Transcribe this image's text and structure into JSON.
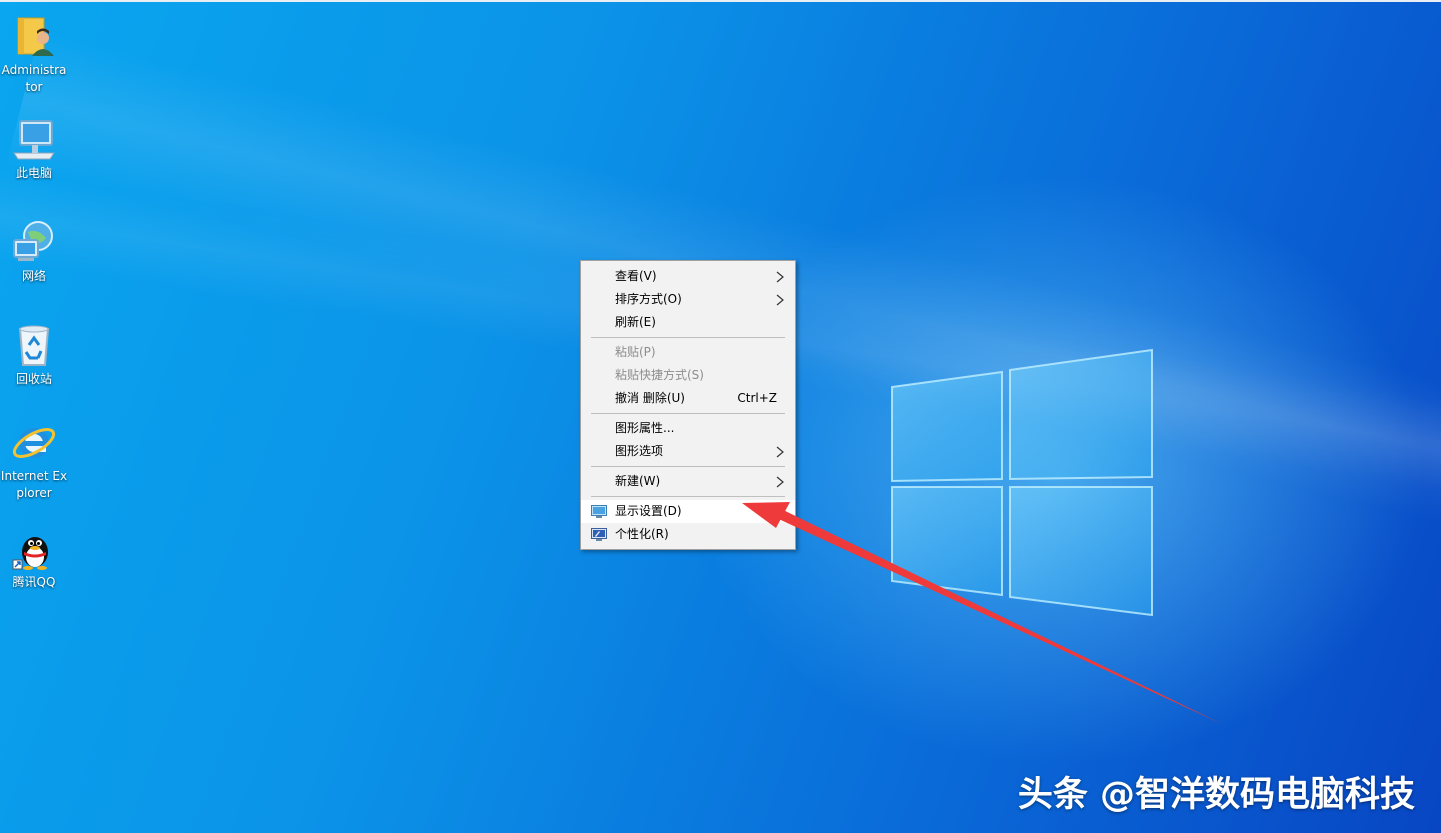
{
  "desktop": {
    "icons": [
      {
        "label": "Administrator",
        "icon": "user-folder-icon"
      },
      {
        "label": "此电脑",
        "icon": "computer-icon"
      },
      {
        "label": "网络",
        "icon": "network-icon"
      },
      {
        "label": "回收站",
        "icon": "recycle-bin-icon"
      },
      {
        "label": "Internet Explorer",
        "icon": "internet-explorer-icon"
      },
      {
        "label": "腾讯QQ",
        "icon": "qq-icon"
      }
    ]
  },
  "context_menu": {
    "items": [
      {
        "label": "查看(V)",
        "submenu": true,
        "enabled": true
      },
      {
        "label": "排序方式(O)",
        "submenu": true,
        "enabled": true
      },
      {
        "label": "刷新(E)",
        "submenu": false,
        "enabled": true
      },
      {
        "label": "粘贴(P)",
        "submenu": false,
        "enabled": false
      },
      {
        "label": "粘贴快捷方式(S)",
        "submenu": false,
        "enabled": false
      },
      {
        "label": "撤消 删除(U)",
        "shortcut": "Ctrl+Z",
        "enabled": true
      },
      {
        "label": "图形属性...",
        "submenu": false,
        "enabled": true
      },
      {
        "label": "图形选项",
        "submenu": true,
        "enabled": true
      },
      {
        "label": "新建(W)",
        "submenu": true,
        "enabled": true
      },
      {
        "label": "显示设置(D)",
        "icon": "display-settings-icon",
        "enabled": true,
        "highlighted": true
      },
      {
        "label": "个性化(R)",
        "icon": "personalize-icon",
        "enabled": true
      }
    ]
  },
  "watermark": {
    "text": "头条 @智洋数码电脑科技"
  },
  "colors": {
    "annotation_arrow": "#ee3a3a",
    "menu_bg": "#f2f2f2",
    "desktop_blue": "#0a8fe6"
  }
}
